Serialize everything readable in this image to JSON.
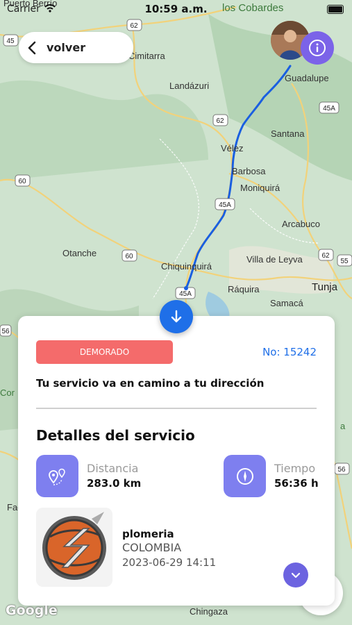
{
  "status_bar": {
    "carrier": "Carrier",
    "time": "10:59 a.m."
  },
  "header": {
    "back_label": "volver"
  },
  "map": {
    "places": [
      "Puerto Berrío",
      "los Cobardes",
      "Cimitarra",
      "Landázuri",
      "Guadalupe",
      "Santana",
      "Vélez",
      "Barbosa",
      "Moniquirá",
      "Arcabuco",
      "Otanche",
      "Chiquinquirá",
      "Villa de Leyva",
      "Ráquira",
      "Tunja",
      "Samacá",
      "Chingaza",
      "Cor",
      "Fac",
      "a"
    ],
    "road_shields": [
      "45",
      "62",
      "62",
      "45A",
      "60",
      "45A",
      "60",
      "62",
      "55",
      "45A",
      "56",
      "56"
    ],
    "attribution": "Google"
  },
  "card": {
    "status_badge": "DEMORADO",
    "order_number": "No: 15242",
    "message": "Tu servicio va en camino a tu dirección",
    "section_title": "Detalles del servicio",
    "distance_label": "Distancia",
    "distance_value": "283.0 km",
    "time_label": "Tiempo",
    "time_value": "56:36 h",
    "service_name": "plomeria",
    "service_country": "COLOMBIA",
    "service_datetime": "2023-06-29 14:11"
  },
  "colors": {
    "accent_blue": "#1f6fe8",
    "accent_purple": "#7b63e8",
    "badge_red": "#f46b6b",
    "route_blue": "#1a5fe0",
    "map_green": "#cfe3cf"
  },
  "icons": [
    "wifi-icon",
    "battery-icon",
    "chevron-left-icon",
    "info-icon",
    "arrow-down-icon",
    "route-pins-icon",
    "compass-icon",
    "service-logo",
    "chevron-down-icon"
  ]
}
